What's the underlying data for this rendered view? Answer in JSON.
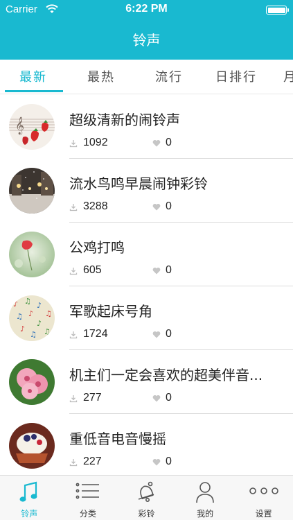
{
  "status_bar": {
    "carrier": "Carrier",
    "time": "6:22 PM"
  },
  "nav": {
    "title": "铃声"
  },
  "tabs": [
    {
      "label": "最新",
      "active": true
    },
    {
      "label": "最热",
      "active": false
    },
    {
      "label": "流行",
      "active": false
    },
    {
      "label": "日排行",
      "active": false
    },
    {
      "label": "月",
      "active": false
    }
  ],
  "ringtones": [
    {
      "title": "超级清新的闹铃声",
      "downloads": "1092",
      "likes": "0",
      "thumb_icon": "strawberry-music-thumbnail"
    },
    {
      "title": "流水鸟鸣早晨闹钟彩铃",
      "downloads": "3288",
      "likes": "0",
      "thumb_icon": "night-street-thumbnail"
    },
    {
      "title": "公鸡打鸣",
      "downloads": "605",
      "likes": "0",
      "thumb_icon": "poppy-field-thumbnail"
    },
    {
      "title": "军歌起床号角",
      "downloads": "1724",
      "likes": "0",
      "thumb_icon": "music-notes-thumbnail"
    },
    {
      "title": "机主们一定会喜欢的超美伴音...",
      "downloads": "277",
      "likes": "0",
      "thumb_icon": "cherry-blossom-thumbnail"
    },
    {
      "title": "重低音电音慢摇",
      "downloads": "227",
      "likes": "0",
      "thumb_icon": "dessert-thumbnail"
    }
  ],
  "tabbar": [
    {
      "label": "铃声",
      "icon": "music-note-icon",
      "active": true
    },
    {
      "label": "分类",
      "icon": "list-icon",
      "active": false
    },
    {
      "label": "彩铃",
      "icon": "bell-icon",
      "active": false
    },
    {
      "label": "我的",
      "icon": "person-icon",
      "active": false
    },
    {
      "label": "设置",
      "icon": "more-dots-icon",
      "active": false
    }
  ],
  "colors": {
    "accent": "#19b9d0",
    "text": "#222222",
    "icon_grey": "#bbbbbb"
  }
}
